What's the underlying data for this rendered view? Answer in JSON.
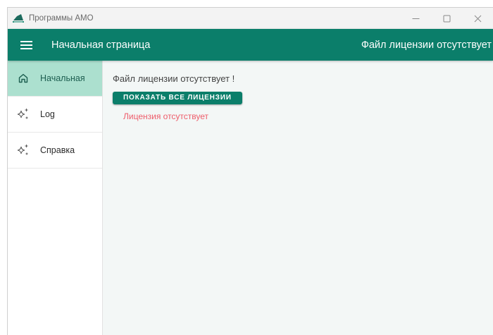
{
  "window": {
    "title": "Программы АМО"
  },
  "appbar": {
    "title": "Начальная страница",
    "status": "Файл лицензии отсутствует !"
  },
  "sidebar": {
    "items": [
      {
        "label": "Начальная",
        "icon": "home-icon",
        "active": true
      },
      {
        "label": "Log",
        "icon": "sparkle-icon",
        "active": false
      },
      {
        "label": "Справка",
        "icon": "sparkle-icon",
        "active": false
      }
    ]
  },
  "content": {
    "message": "Файл лицензии отсутствует !",
    "show_licenses_button": "показать все лицензии",
    "license_status": "Лицензия отсутствует"
  },
  "colors": {
    "primary": "#0b7e6a",
    "active_nav": "#ace0cf",
    "error_text": "#ee5c6a",
    "content_bg": "#f3f7f6"
  }
}
